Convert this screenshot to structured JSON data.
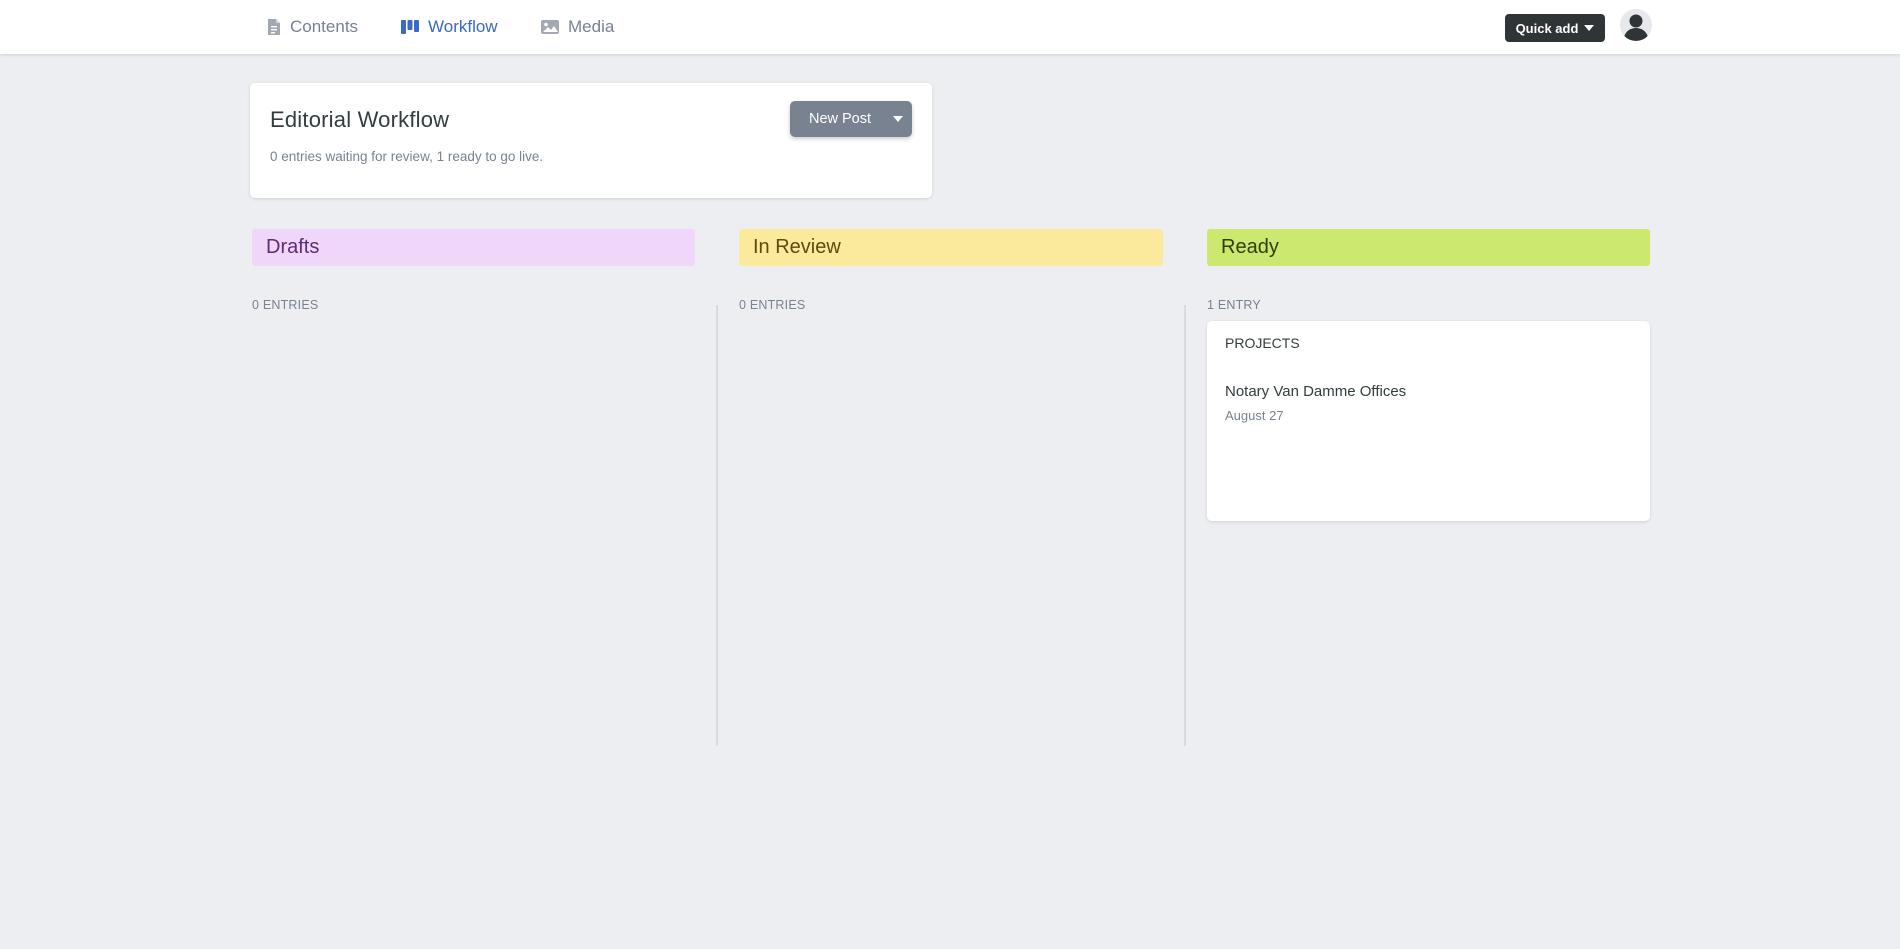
{
  "nav": {
    "items": [
      {
        "label": "Contents",
        "icon": "document-icon",
        "active": false
      },
      {
        "label": "Workflow",
        "icon": "kanban-icon",
        "active": true
      },
      {
        "label": "Media",
        "icon": "image-icon",
        "active": false
      }
    ],
    "quick_add_label": "Quick add"
  },
  "header": {
    "title": "Editorial Workflow",
    "subtitle": "0 entries waiting for review, 1 ready to go live.",
    "new_post_label": "New Post"
  },
  "columns": [
    {
      "title": "Drafts",
      "count_label": "0 ENTRIES",
      "color": "#f0d6fa",
      "text_color": "#5e2a7a"
    },
    {
      "title": "In Review",
      "count_label": "0 ENTRIES",
      "color": "#fbe99c",
      "text_color": "#5c4b0b"
    },
    {
      "title": "Ready",
      "count_label": "1 ENTRY",
      "color": "#cde86f",
      "text_color": "#2c4205"
    }
  ],
  "ready_entries": [
    {
      "collection": "PROJECTS",
      "title": "Notary Van Damme Offices",
      "date": "August 27"
    }
  ],
  "colors": {
    "accent": "#3a69c7",
    "background": "#eceef2",
    "button_dark": "#2f3436",
    "button_gray": "#798291"
  }
}
